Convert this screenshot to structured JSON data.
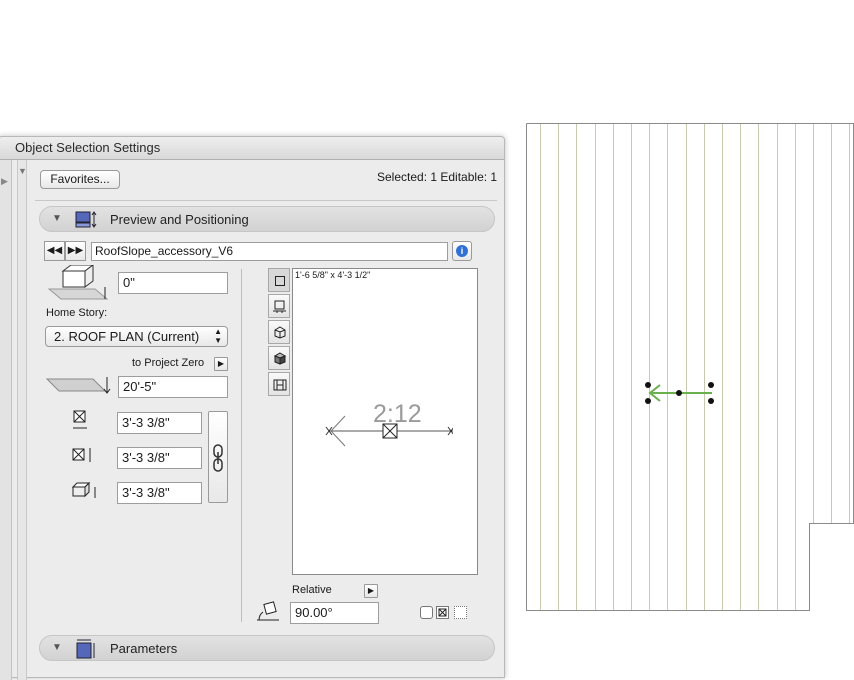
{
  "window": {
    "title": "Object Selection Settings"
  },
  "header": {
    "favorites_label": "Favorites...",
    "selection_status": "Selected: 1 Editable: 1"
  },
  "preview_section": {
    "label": "Preview and Positioning"
  },
  "object": {
    "name": "RoofSlope_accessory_V6"
  },
  "positioning": {
    "elevation_value": "0\"",
    "home_story_label": "Home Story:",
    "home_story_value": "2. ROOF PLAN (Current)",
    "to_project_zero_label": "to Project Zero",
    "project_zero_value": "20'-5\"",
    "width_value": "3'-3 3/8\"",
    "depth_value": "3'-3 3/8\"",
    "height_value": "3'-3 3/8\""
  },
  "preview": {
    "dimension_text": "1'-6 5/8\" x 4'-3 1/2\"",
    "slope_text": "2:12"
  },
  "orientation": {
    "relative_label": "Relative",
    "angle_value": "90.00°"
  },
  "parameters_section": {
    "label": "Parameters"
  },
  "colors": {
    "accent_blue": "#2f6fd6",
    "arrow_green": "#6ab04c",
    "plan_line": "#c9c9b0"
  }
}
